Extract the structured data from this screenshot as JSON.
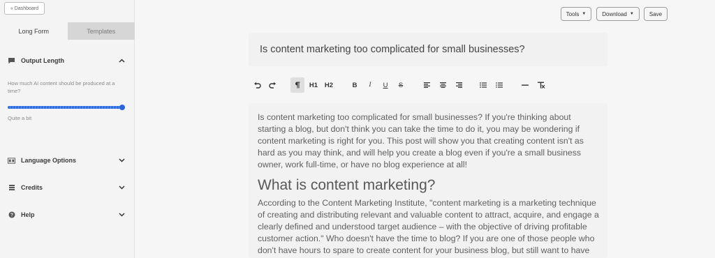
{
  "sidebar": {
    "dashboard_label": "« Dashboard",
    "tabs": [
      {
        "label": "Long Form",
        "active": true
      },
      {
        "label": "Templates",
        "active": false
      }
    ],
    "output_length": {
      "title": "Output Length",
      "icon": "chat-bubble-icon",
      "question": "How much AI content should be produced at a time?",
      "slider_value": 1.0,
      "value_label": "Quite a bit"
    },
    "sections": [
      {
        "label": "Language Options",
        "icon": "translate-icon"
      },
      {
        "label": "Credits",
        "icon": "stack-icon"
      },
      {
        "label": "Help",
        "icon": "help-circle-icon"
      }
    ]
  },
  "header": {
    "tools_label": "Tools",
    "download_label": "Download",
    "save_label": "Save"
  },
  "editor": {
    "title": "Is content marketing too complicated for small businesses?",
    "toolbar": {
      "h1": "H1",
      "h2": "H2",
      "bold": "B",
      "italic": "I",
      "underline": "U",
      "strike": "S"
    },
    "paragraph1": "Is content marketing too complicated for small businesses? If you're thinking about starting a blog, but don't think you can take the time to do it, you may be wondering if content marketing is right for you. This post will show you that creating content isn't as hard as you may think, and will help you create a blog even if you're a small business owner, work full-time, or have no blog experience at all!",
    "heading": "What is content marketing?",
    "paragraph2": "According to the Content Marketing Institute, \"content marketing is a marketing technique of creating and distributing relevant and valuable content to attract, acquire, and engage a clearly defined and understood target audience – with the objective of driving profitable customer action.\" Who doesn't have the time to blog? If you are one of those people who don't have hours to spare to create content for your business blog, but still want to have"
  },
  "colors": {
    "accent": "#2f6fe0",
    "sidebar_bg": "#f4f4f4",
    "editor_bg": "#f2f2f2"
  }
}
